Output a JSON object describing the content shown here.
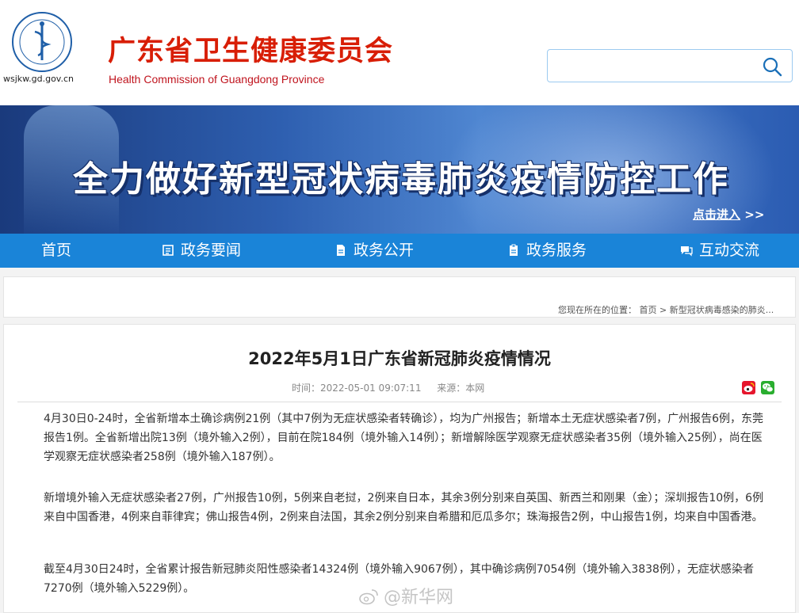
{
  "header": {
    "org_name_cn": "广东省卫生健康委员会",
    "org_name_en": "Health Commission of Guangdong Province",
    "domain": "wsjkw.gd.gov.cn",
    "search_placeholder": ""
  },
  "banner": {
    "title": "全力做好新型冠状病毒肺炎疫情防控工作",
    "link_label": "点击进入",
    "link_arrow": ">>"
  },
  "nav": {
    "items": [
      {
        "label": "首页",
        "icon": ""
      },
      {
        "label": "政务要闻",
        "icon": "news-icon"
      },
      {
        "label": "政务公开",
        "icon": "document-icon"
      },
      {
        "label": "政务服务",
        "icon": "clipboard-icon"
      },
      {
        "label": "互动交流",
        "icon": "chat-icon"
      }
    ]
  },
  "breadcrumb": {
    "prefix": "您现在所在的位置：",
    "home": "首页",
    "separator": ">",
    "current": "新型冠状病毒感染的肺炎..."
  },
  "article": {
    "title": "2022年5月1日广东省新冠肺炎疫情情况",
    "time_label": "时间：2022-05-01 09:07:11",
    "source_label": "来源：本网",
    "paragraphs": [
      "4月30日0-24时，全省新增本土确诊病例21例（其中7例为无症状感染者转确诊），均为广州报告；新增本土无症状感染者7例，广州报告6例，东莞报告1例。全省新增出院13例（境外输入2例），目前在院184例（境外输入14例）；新增解除医学观察无症状感染者35例（境外输入25例），尚在医学观察无症状感染者258例（境外输入187例）。",
      "新增境外输入无症状感染者27例，广州报告10例，5例来自老挝，2例来自日本，其余3例分别来自英国、新西兰和刚果（金）；深圳报告10例，6例来自中国香港，4例来自菲律宾；佛山报告4例，2例来自法国，其余2例分别来自希腊和厄瓜多尔；珠海报告2例，中山报告1例，均来自中国香港。",
      "截至4月30日24时，全省累计报告新冠肺炎阳性感染者14324例（境外输入9067例），其中确诊病例7054例（境外输入3838例），无症状感染者7270例（境外输入5229例）。"
    ]
  },
  "watermark": {
    "text": "@新华网"
  },
  "colors": {
    "brand_red": "#d81e06",
    "nav_blue": "#1a84d8",
    "banner_blue": "#2e5fb0"
  }
}
